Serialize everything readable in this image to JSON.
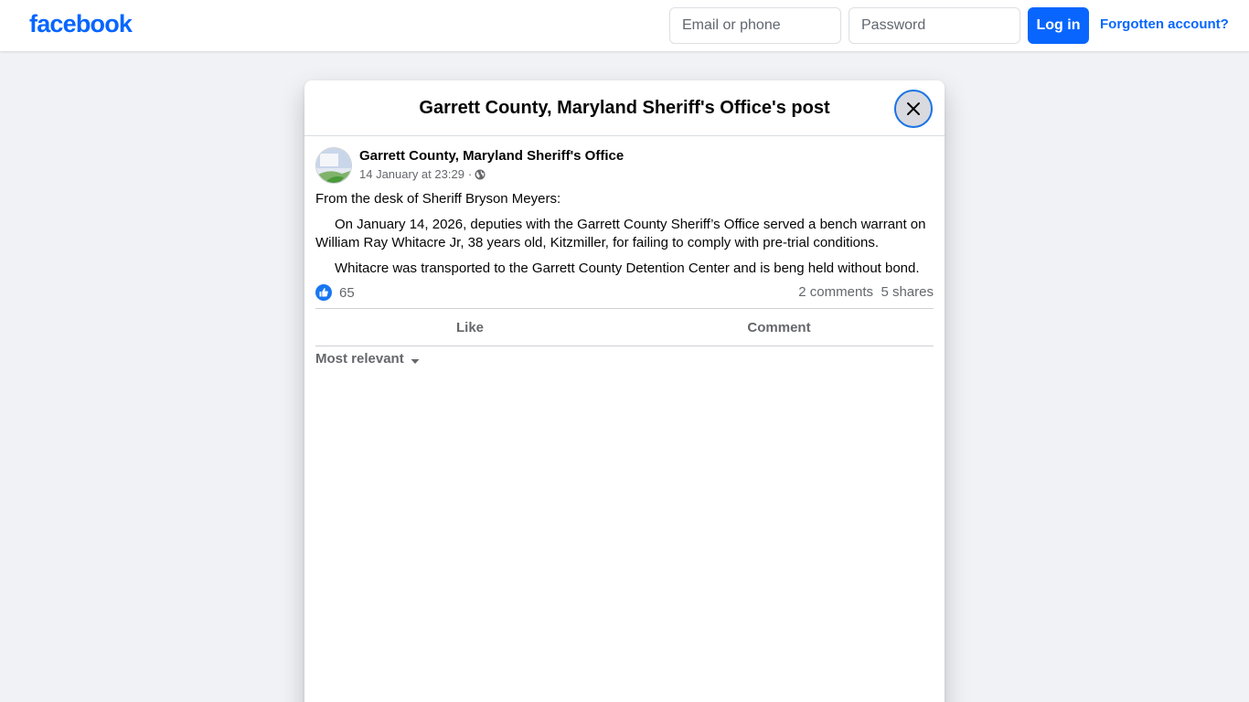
{
  "topbar": {
    "logo_text": "facebook",
    "email_placeholder": "Email or phone",
    "password_placeholder": "Password",
    "login_label": "Log in",
    "forgot_label": "Forgotten account?"
  },
  "dialog": {
    "title": "Garrett County, Maryland Sheriff's Office's post",
    "close_icon": "close-icon"
  },
  "post": {
    "author": "Garrett County, Maryland Sheriff's Office",
    "timestamp": "14 January at 23:29",
    "separator": "·",
    "audience_icon": "globe-icon",
    "paragraphs": [
      "From the desk of Sheriff Bryson Meyers:",
      "On January 14, 2026, deputies with the Garrett County Sheriff’s Office served a bench warrant on William Ray Whitacre Jr, 38 years old, Kitzmiller, for failing to comply with pre-trial conditions.",
      "Whitacre was transported to the Garrett County Detention Center and is beng held without bond."
    ],
    "reaction_icon": "like-reaction-icon",
    "reaction_count": "65",
    "comments_label": "2 comments",
    "shares_label": "5 shares"
  },
  "actions": {
    "like_label": "Like",
    "comment_label": "Comment"
  },
  "comments": {
    "sort_label": "Most relevant"
  },
  "colors": {
    "brand_blue": "#0866ff",
    "page_background": "#f0f2f5",
    "secondary_text": "#65676b"
  }
}
